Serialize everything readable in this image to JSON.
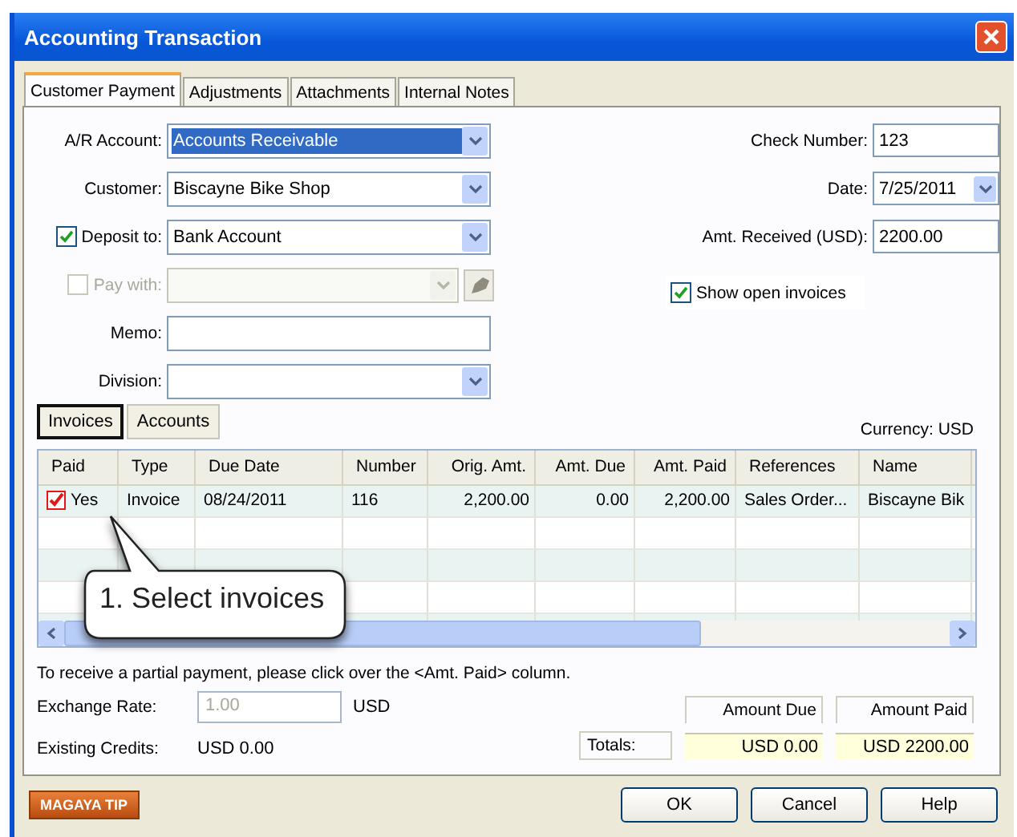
{
  "window": {
    "title": "Accounting Transaction"
  },
  "tabs": [
    {
      "label": "Customer Payment",
      "selected": true
    },
    {
      "label": "Adjustments",
      "selected": false
    },
    {
      "label": "Attachments",
      "selected": false
    },
    {
      "label": "Internal Notes",
      "selected": false
    }
  ],
  "left_fields": [
    {
      "kind": "dropdown",
      "label": "A/R Account:",
      "value": "Accounts Receivable",
      "highlighted": true,
      "disabled": false
    },
    {
      "kind": "dropdown",
      "label": "Customer:",
      "value": "Biscayne Bike Shop",
      "highlighted": false,
      "disabled": false
    },
    {
      "kind": "check-dropdown",
      "label": "Deposit to:",
      "checked": true,
      "value": "Bank Account",
      "highlighted": false,
      "disabled": false
    },
    {
      "kind": "check-dropdown-tool",
      "label": "Pay with:",
      "checked": false,
      "disabled": true
    },
    {
      "kind": "text",
      "label": "Memo:",
      "disabled": false
    },
    {
      "kind": "dropdown",
      "label": "Division:",
      "disabled": false
    }
  ],
  "right_fields": [
    {
      "kind": "text",
      "label": "Check Number:",
      "value": "123"
    },
    {
      "kind": "dropdown",
      "label": "Date:",
      "value": "7/25/2011"
    },
    {
      "kind": "text",
      "label": "Amt. Received (USD):",
      "value": "2200.00"
    }
  ],
  "show_open_invoices": {
    "label": "Show open invoices",
    "checked": true
  },
  "subtabs": [
    {
      "label": "Invoices",
      "selected": true
    },
    {
      "label": "Accounts",
      "selected": false
    }
  ],
  "currency": "Currency: USD",
  "table": {
    "columns": [
      "Paid",
      "Type",
      "Due Date",
      "Number",
      "Orig. Amt.",
      "Amt. Due",
      "Amt. Paid",
      "References",
      "Name"
    ],
    "rows": [
      {
        "paid": true,
        "cells": [
          "Yes",
          "Invoice",
          "08/24/2011",
          "116",
          "2,200.00",
          "0.00",
          "2,200.00",
          "Sales Order...",
          "Biscayne Bik"
        ]
      }
    ]
  },
  "callout": {
    "text": "1. Select invoices"
  },
  "note": "To receive a partial payment, please click over the <Amt. Paid> column.",
  "exchange_rate": {
    "label": "Exchange Rate:",
    "value": "1.00",
    "unit": "USD",
    "disabled": true
  },
  "existing_credits": {
    "label": "Existing Credits:",
    "value": "USD 0.00"
  },
  "totals": {
    "label": "Totals:",
    "headers": [
      "Amount Due",
      "Amount Paid"
    ],
    "values": [
      "USD 0.00",
      "USD 2200.00"
    ]
  },
  "tip_button": "MAGAYA TIP",
  "buttons": [
    "OK",
    "Cancel",
    "Help"
  ]
}
